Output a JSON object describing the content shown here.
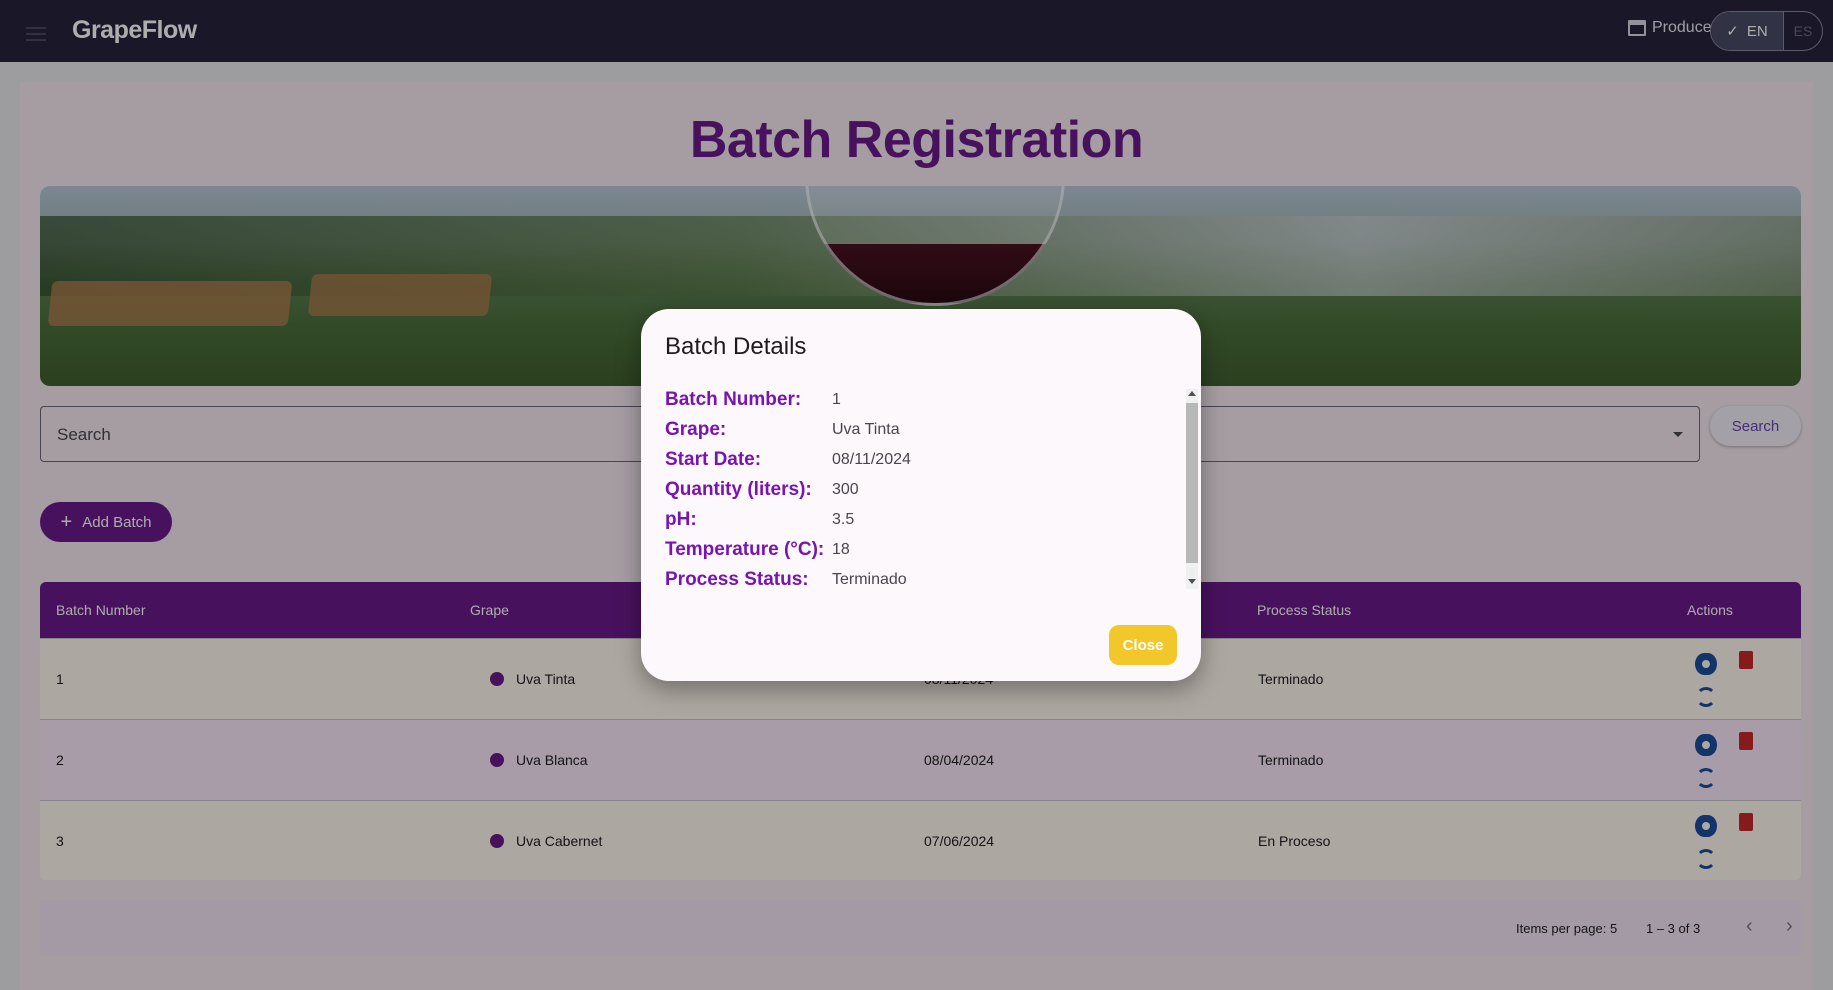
{
  "app": {
    "brand": "GrapeFlow",
    "role": "Producer",
    "lang_active": "EN",
    "lang_other": "ES"
  },
  "page": {
    "title": "Batch Registration"
  },
  "search": {
    "placeholder": "Search",
    "button": "Search"
  },
  "actions": {
    "add_batch": "Add Batch"
  },
  "table": {
    "headers": {
      "batch_number": "Batch Number",
      "grape": "Grape",
      "process_status": "Process Status",
      "actions": "Actions"
    },
    "rows": [
      {
        "batch_number": "1",
        "grape": "Uva Tinta",
        "start_date": "08/11/2024",
        "process_status": "Terminado"
      },
      {
        "batch_number": "2",
        "grape": "Uva Blanca",
        "start_date": "08/04/2024",
        "process_status": "Terminado"
      },
      {
        "batch_number": "3",
        "grape": "Uva Cabernet",
        "start_date": "07/06/2024",
        "process_status": "En Proceso"
      }
    ]
  },
  "paginator": {
    "items_per_page": "Items per page: 5",
    "range": "1 – 3 of 3"
  },
  "dialog": {
    "title": "Batch Details",
    "fields": [
      {
        "label": "Batch Number:",
        "value": "1"
      },
      {
        "label": "Grape:",
        "value": "Uva Tinta"
      },
      {
        "label": "Start Date:",
        "value": "08/11/2024"
      },
      {
        "label": "Quantity (liters):",
        "value": "300"
      },
      {
        "label": "pH:",
        "value": "3.5"
      },
      {
        "label": "Temperature (°C):",
        "value": "18"
      },
      {
        "label": "Process Status:",
        "value": "Terminado"
      }
    ],
    "close": "Close"
  },
  "colors": {
    "topbar": "#25223c",
    "primary": "#6a1a8a",
    "label": "#7a14b0",
    "close_button": "#f2c72a",
    "delete": "#c62828",
    "view": "#1a4d9e"
  },
  "icons": [
    "menu-icon",
    "store-icon",
    "check-icon",
    "add-icon",
    "grape-icon",
    "eye-icon",
    "trash-icon",
    "sync-icon",
    "dropdown-arrow-icon",
    "chevron-left-icon",
    "chevron-right-icon"
  ]
}
